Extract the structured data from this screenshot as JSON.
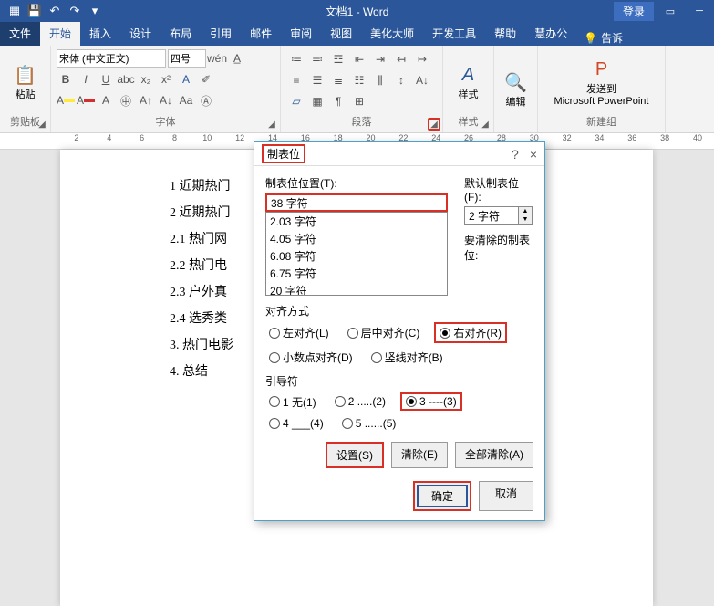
{
  "title": "文档1 - Word",
  "qat": [
    "save",
    "undo",
    "redo",
    "touch"
  ],
  "login_label": "登录",
  "tabs": {
    "file": "文件",
    "home": "开始",
    "insert": "插入",
    "design": "设计",
    "layout": "布局",
    "references": "引用",
    "mail": "邮件",
    "review": "审阅",
    "view": "视图",
    "beautify": "美化大师",
    "developer": "开发工具",
    "help": "帮助",
    "huioffice": "慧办公",
    "tell": "告诉"
  },
  "ribbon": {
    "clipboard": {
      "label": "剪贴板",
      "paste": "粘贴"
    },
    "font": {
      "label": "字体",
      "name": "宋体 (中文正文)",
      "size": "四号"
    },
    "paragraph": {
      "label": "段落"
    },
    "styles": {
      "label": "样式",
      "button": "样式"
    },
    "editing": {
      "label": "",
      "button": "编辑"
    },
    "sendto": {
      "group_label": "新建组",
      "button": "发送到",
      "sub": "Microsoft PowerPoint"
    }
  },
  "ruler_marks": [
    "2",
    "4",
    "6",
    "8",
    "10",
    "12",
    "14",
    "16",
    "18",
    "20",
    "22",
    "24",
    "26",
    "28",
    "30",
    "32",
    "34",
    "36",
    "38",
    "40"
  ],
  "doc_lines": [
    "1 近期热门",
    "2 近期热门",
    "2.1 热门网",
    "2.2 热门电",
    "2.3 户外真",
    "2.4 选秀类",
    "3. 热门电影",
    "4. 总结"
  ],
  "dialog": {
    "title": "制表位",
    "help": "?",
    "close": "×",
    "pos_label": "制表位位置(T):",
    "pos_value": "38 字符",
    "pos_list": [
      "2.03 字符",
      "4.05 字符",
      "6.08 字符",
      "6.75 字符",
      "20 字符"
    ],
    "default_label": "默认制表位(F):",
    "default_value": "2 字符",
    "clear_list_label": "要清除的制表位:",
    "align_label": "对齐方式",
    "align": {
      "left": "左对齐(L)",
      "center": "居中对齐(C)",
      "right": "右对齐(R)",
      "decimal": "小数点对齐(D)",
      "bar": "竖线对齐(B)"
    },
    "leader_label": "引导符",
    "leader": {
      "none": "1 无(1)",
      "dots": "2 .....(2)",
      "dash": "3 ----(3)",
      "under": "4 ___(4)",
      "mdots": "5 ......(5)"
    },
    "btn_set": "设置(S)",
    "btn_clear": "清除(E)",
    "btn_clear_all": "全部清除(A)",
    "btn_ok": "确定",
    "btn_cancel": "取消"
  }
}
